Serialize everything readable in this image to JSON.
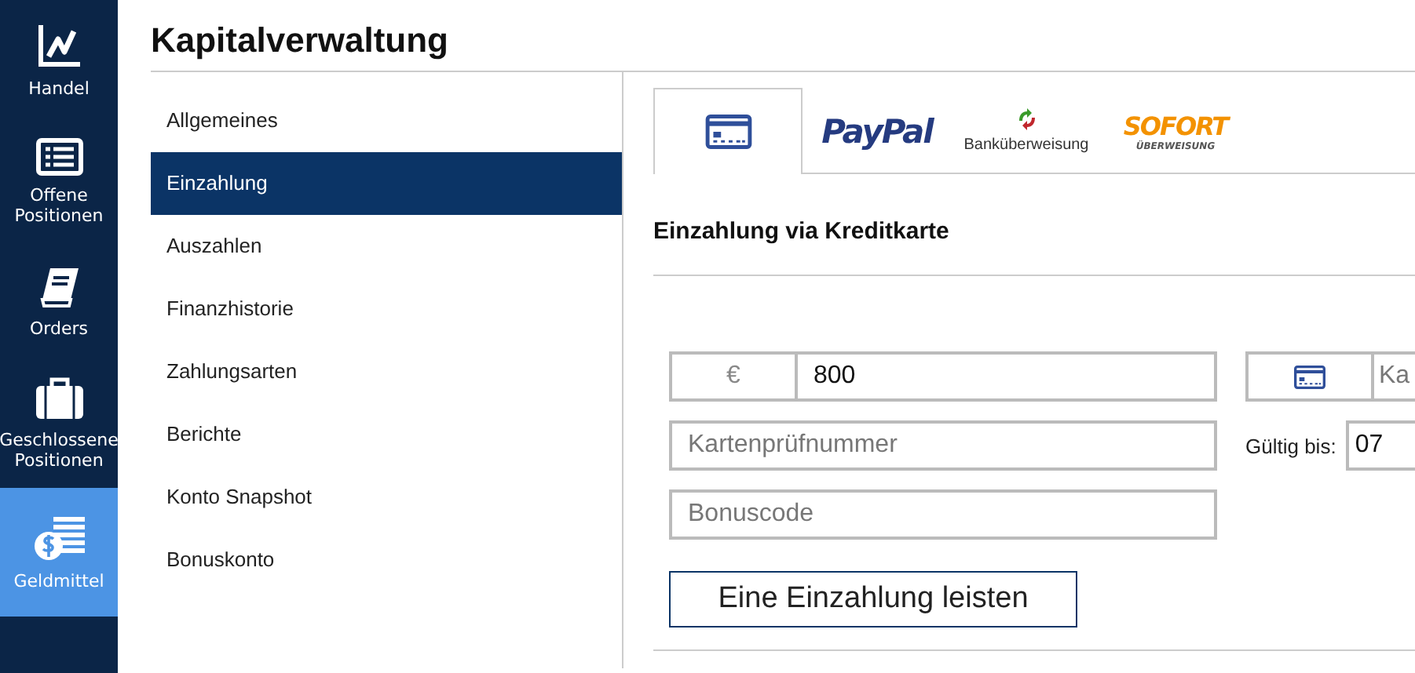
{
  "nav": [
    {
      "kind": "chart",
      "label": "Handel",
      "selected": false
    },
    {
      "kind": "list",
      "label": "Offene Positionen",
      "selected": false
    },
    {
      "kind": "book",
      "label": "Orders",
      "selected": false
    },
    {
      "kind": "case",
      "label": "Geschlossene Positionen",
      "selected": false
    },
    {
      "kind": "money",
      "label": "Geldmittel",
      "selected": true
    }
  ],
  "title": "Kapitalverwaltung",
  "menu": [
    {
      "label": "Allgemeines",
      "selected": false
    },
    {
      "label": "Einzahlung",
      "selected": true
    },
    {
      "label": "Auszahlen",
      "selected": false
    },
    {
      "label": "Finanzhistorie",
      "selected": false
    },
    {
      "label": "Zahlungsarten",
      "selected": false
    },
    {
      "label": "Berichte",
      "selected": false
    },
    {
      "label": "Konto Snapshot",
      "selected": false
    },
    {
      "label": "Bonuskonto",
      "selected": false
    }
  ],
  "tabs": [
    {
      "kind": "card",
      "selected": true
    },
    {
      "kind": "paypal",
      "label": "PayPal",
      "selected": false
    },
    {
      "kind": "bank",
      "label": "Banküberweisung",
      "selected": false
    },
    {
      "kind": "sofort",
      "label": "SOFORT",
      "sublabel": "ÜBERWEISUNG",
      "selected": false
    }
  ],
  "heading": "Einzahlung via Kreditkarte",
  "form": {
    "currency": "€",
    "amount": "800",
    "cvv_placeholder": "Kartenprüfnummer",
    "bonus_placeholder": "Bonuscode",
    "card_number_placeholder": "Ka",
    "expiry_label": "Gültig bis:",
    "expiry_month": "07",
    "submit": "Eine Einzahlung leisten"
  }
}
